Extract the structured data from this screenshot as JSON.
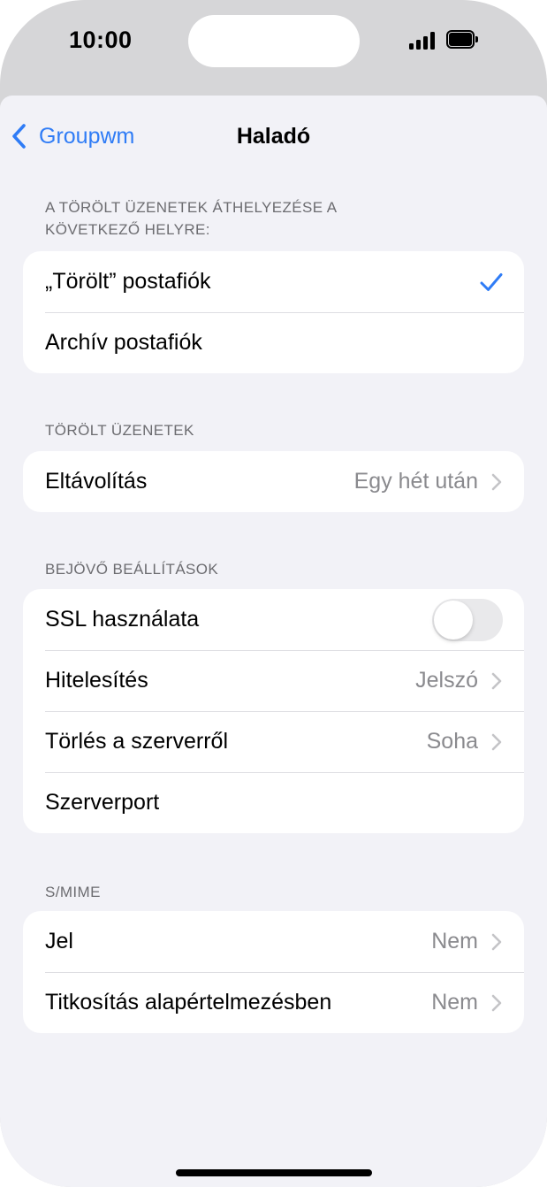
{
  "status_bar": {
    "time": "10:00"
  },
  "nav": {
    "back_label": "Groupwm",
    "title": "Haladó"
  },
  "sections": [
    {
      "header": "A TÖRÖLT ÜZENETEK ÁTHELYEZÉSE A KÖVETKEZŐ HELYRE:",
      "rows": [
        {
          "label": "„Törölt” postafiók",
          "checked": true
        },
        {
          "label": "Archív postafiók",
          "checked": false
        }
      ]
    },
    {
      "header": "TÖRÖLT ÜZENETEK",
      "rows": [
        {
          "label": "Eltávolítás",
          "value": "Egy hét után"
        }
      ]
    },
    {
      "header": "BEJÖVŐ BEÁLLÍTÁSOK",
      "rows": [
        {
          "label": "SSL használata",
          "toggle": false
        },
        {
          "label": "Hitelesítés",
          "value": "Jelszó"
        },
        {
          "label": "Törlés a szerverről",
          "value": "Soha"
        },
        {
          "label": "Szerverport",
          "value": ""
        }
      ]
    },
    {
      "header": "S/MIME",
      "rows": [
        {
          "label": "Jel",
          "value": "Nem"
        },
        {
          "label": "Titkosítás alapértelmezésben",
          "value": "Nem"
        }
      ]
    }
  ],
  "colors": {
    "accent": "#2f7cf6",
    "background": "#f2f2f7",
    "secondary_text": "#8a8a8e"
  }
}
